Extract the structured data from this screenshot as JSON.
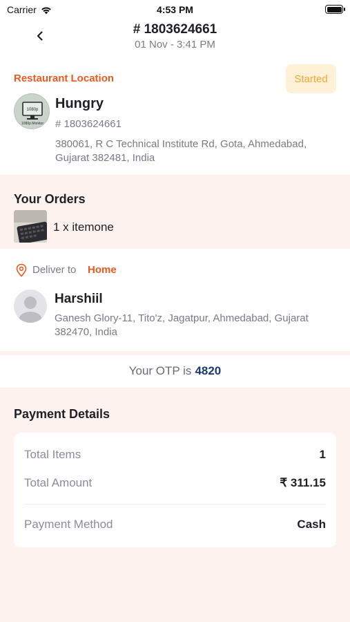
{
  "status_bar": {
    "carrier": "Carrier",
    "time": "4:53 PM",
    "icons": [
      "wifi-icon",
      "battery-icon"
    ]
  },
  "header": {
    "order_id": "# 1803624661",
    "date": "01 Nov - 3:41 PM",
    "back_icon": "chevron-left-icon"
  },
  "restaurant": {
    "section_label": "Restaurant Location",
    "status": "Started",
    "name": "Hungry",
    "id": "# 1803624661",
    "address": "380061, R C Technical Institute Rd, Gota, Ahmedabad, Gujarat 382481, India",
    "logo_text_top": "1080p",
    "logo_text_bottom": "1080p Monitor"
  },
  "orders": {
    "title": "Your Orders",
    "items": [
      {
        "label": "1 x itemone"
      }
    ]
  },
  "delivery": {
    "label": "Deliver to",
    "type": "Home",
    "customer_name": "Harshiil",
    "address": "Ganesh Glory-11, Tito'z, Jagatpur, Ahmedabad, Gujarat 382470, India",
    "icon": "location-pin-icon"
  },
  "otp": {
    "label": "Your OTP is",
    "code": "4820"
  },
  "payment": {
    "title": "Payment Details",
    "rows": [
      {
        "label": "Total Items",
        "value": "1"
      },
      {
        "label": "Total Amount",
        "value": "₹ 311.15"
      },
      {
        "label": "Payment Method",
        "value": "Cash"
      }
    ]
  },
  "colors": {
    "accent": "#ea5a1f",
    "badge_bg": "#fff1d8",
    "badge_text": "#f3a82e",
    "section_bg": "#fdf2ee",
    "otp_code": "#1b3a6e"
  }
}
